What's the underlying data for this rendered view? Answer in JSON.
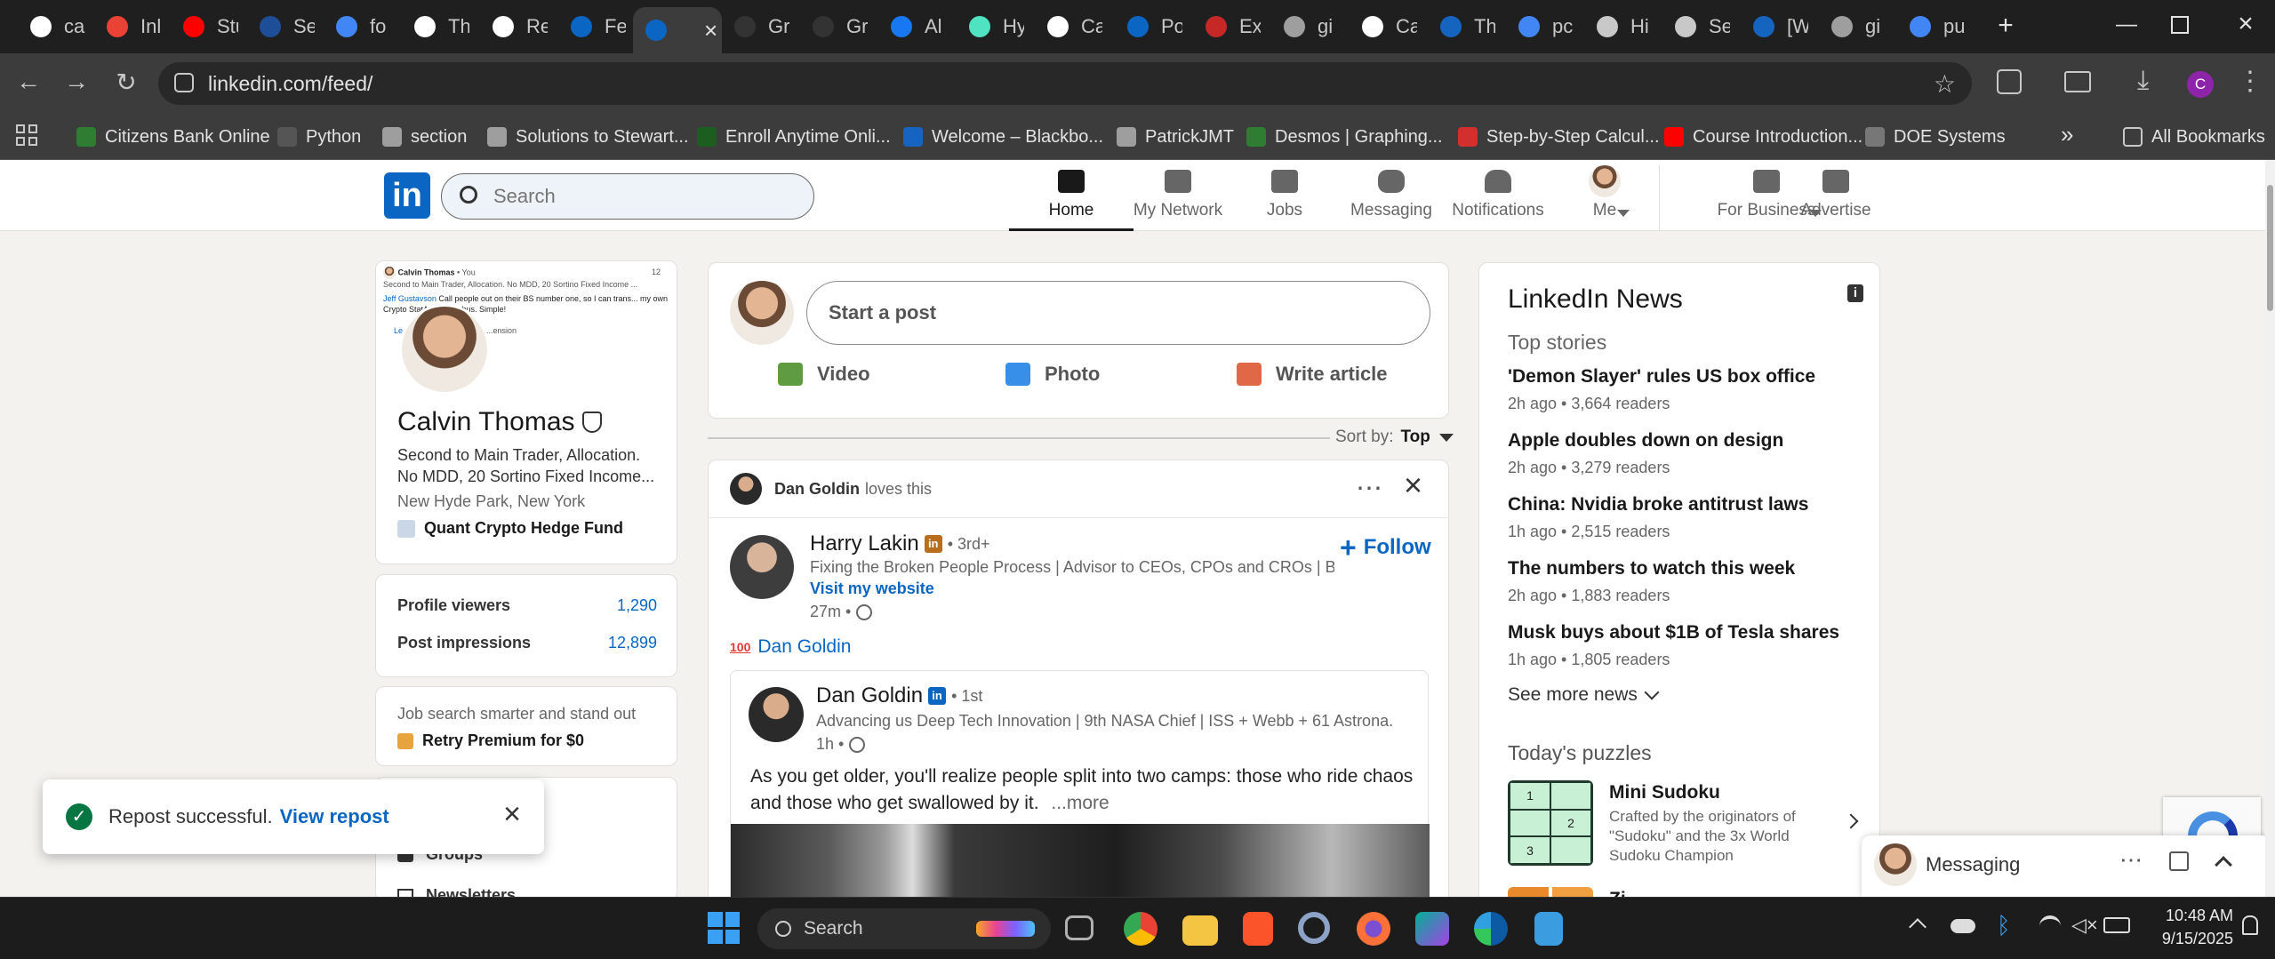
{
  "browser": {
    "tabs": [
      {
        "title": "ca",
        "icon": "github-icon",
        "color": "#ffffff"
      },
      {
        "title": "Inl",
        "icon": "gmail-icon",
        "color": "#ea4335"
      },
      {
        "title": "Stu",
        "icon": "youtube-icon",
        "color": "#ff0000"
      },
      {
        "title": "Se",
        "icon": "ssn-icon",
        "color": "#1f4e99"
      },
      {
        "title": "fo",
        "icon": "google-icon",
        "color": "#4285f4"
      },
      {
        "title": "Th",
        "icon": "r-icon",
        "color": "#ffffff"
      },
      {
        "title": "Re",
        "icon": "r-icon",
        "color": "#ffffff"
      },
      {
        "title": "Fe",
        "icon": "linkedin-icon",
        "color": "#0a66c2"
      },
      {
        "title": "",
        "icon": "linkedin-icon",
        "color": "#0a66c2",
        "active": true
      },
      {
        "title": "Gr",
        "icon": "grok-icon",
        "color": "#333333"
      },
      {
        "title": "Gr",
        "icon": "grok-icon",
        "color": "#333333"
      },
      {
        "title": "Al",
        "icon": "meta-icon",
        "color": "#1877f2"
      },
      {
        "title": "Hy",
        "icon": "hyper-icon",
        "color": "#50e3c2"
      },
      {
        "title": "Ca",
        "icon": "x-icon",
        "color": "#ffffff"
      },
      {
        "title": "Po",
        "icon": "linkedin-icon",
        "color": "#0a66c2"
      },
      {
        "title": "Ex",
        "icon": "excel-icon",
        "color": "#c62828"
      },
      {
        "title": "gi",
        "icon": "globe-icon",
        "color": "#9e9e9e"
      },
      {
        "title": "Ca",
        "icon": "x-icon",
        "color": "#ffffff"
      },
      {
        "title": "Th",
        "icon": "thumb-icon",
        "color": "#1565c0"
      },
      {
        "title": "pc",
        "icon": "google-icon",
        "color": "#4285f4"
      },
      {
        "title": "Hi",
        "icon": "history-icon",
        "color": "#c8c8c8"
      },
      {
        "title": "Se",
        "icon": "settings-icon",
        "color": "#c8c8c8"
      },
      {
        "title": "[W",
        "icon": "plugin-icon",
        "color": "#1565c0"
      },
      {
        "title": "gi",
        "icon": "globe-icon",
        "color": "#9e9e9e"
      },
      {
        "title": "pu",
        "icon": "google-icon",
        "color": "#4285f4"
      }
    ],
    "url": "linkedin.com/feed/",
    "profile_initial": "C",
    "bookmarks": [
      {
        "label": "Citizens Bank Online",
        "color": "#2e7d32"
      },
      {
        "label": "Python",
        "color": "#555555"
      },
      {
        "label": "section",
        "color": "#9e9e9e"
      },
      {
        "label": "Solutions to Stewart...",
        "color": "#9e9e9e"
      },
      {
        "label": "Enroll Anytime Onli...",
        "color": "#1b5e20"
      },
      {
        "label": "Welcome – Blackbo...",
        "color": "#1565c0"
      },
      {
        "label": "PatrickJMT",
        "color": "#9e9e9e"
      },
      {
        "label": "Desmos | Graphing...",
        "color": "#2e7d32"
      },
      {
        "label": "Step-by-Step Calcul...",
        "color": "#d32f2f"
      },
      {
        "label": "Course Introduction...",
        "color": "#ff0000"
      },
      {
        "label": "DOE Systems",
        "color": "#777777"
      }
    ],
    "all_bookmarks": "All Bookmarks",
    "more_bookmarks": "»"
  },
  "linkedin": {
    "logo": "in",
    "search_placeholder": "Search",
    "nav": [
      {
        "label": "Home",
        "icon": "home-icon",
        "active": true
      },
      {
        "label": "My Network",
        "icon": "network-icon"
      },
      {
        "label": "Jobs",
        "icon": "jobs-icon"
      },
      {
        "label": "Messaging",
        "icon": "messaging-icon"
      },
      {
        "label": "Notifications",
        "icon": "bell-icon"
      },
      {
        "label": "Me",
        "icon": "avatar"
      },
      {
        "label": "For Business",
        "icon": "grid-icon"
      },
      {
        "label": "Advertise",
        "icon": "advertise-icon"
      }
    ],
    "profile": {
      "banner_name": "Calvin Thomas",
      "banner_time": "• You",
      "banner_sub": "Second to Main Trader, Allocation. No MDD, 20 Sortino Fixed Income ...",
      "banner_mention": "Jeff Gustavson",
      "banner_text": "Call people out on their BS number one, so I can trans... my own Crypto StatArb Quant bus. Simple!",
      "banner_sidetext": "Le...",
      "banner_sidetext2": "...ension",
      "banner_count": "12",
      "name": "Calvin Thomas",
      "headline": "Second to Main Trader, Allocation. No MDD, 20 Sortino Fixed Income...",
      "location": "New Hyde Park, New York",
      "company": "Quant Crypto Hedge Fund",
      "stats": [
        {
          "label": "Profile viewers",
          "value": "1,290"
        },
        {
          "label": "Post impressions",
          "value": "12,899"
        }
      ],
      "premium_text": "Job search smarter and stand out",
      "premium_cta": "Retry Premium for $0",
      "extra_items": [
        "Groups",
        "Newsletters"
      ]
    },
    "share": {
      "placeholder": "Start a post",
      "actions": [
        {
          "label": "Video",
          "icon": "video-icon",
          "color": "#378fe9"
        },
        {
          "label": "Photo",
          "icon": "photo-icon",
          "color": "#378fe9"
        },
        {
          "label": "Write article",
          "icon": "article-icon",
          "color": "#e06847"
        }
      ]
    },
    "sort": {
      "label": "Sort by:",
      "value": "Top"
    },
    "post": {
      "context_name": "Dan Goldin",
      "context_action": "loves this",
      "author": "Harry Lakin",
      "author_degree": "• 3rd+",
      "author_headline": "Fixing the Broken People Process | Advisor to CEOs, CPOs and CROs | B...",
      "author_link": "Visit my website",
      "time": "27m •",
      "follow": "Follow",
      "reaction_name": "Dan Goldin",
      "reaction_badge": "100",
      "inner": {
        "author": "Dan Goldin",
        "degree": "• 1st",
        "headline": "Advancing us Deep Tech Innovation | 9th NASA Chief | ISS + Webb + 61 Astrona...",
        "time": "1h •",
        "text": "As you get older, you'll realize people split into two camps: those who ride chaos and those who get swallowed by it.",
        "more": "...more"
      }
    },
    "news": {
      "title": "LinkedIn News",
      "subtitle": "Top stories",
      "items": [
        {
          "headline": "'Demon Slayer' rules US box office",
          "meta": "2h ago • 3,664 readers"
        },
        {
          "headline": "Apple doubles down on design",
          "meta": "2h ago • 3,279 readers"
        },
        {
          "headline": "China: Nvidia broke antitrust laws",
          "meta": "1h ago • 2,515 readers"
        },
        {
          "headline": "The numbers to watch this week",
          "meta": "2h ago • 1,883 readers"
        },
        {
          "headline": "Musk buys about $1B of Tesla shares",
          "meta": "1h ago • 1,805 readers"
        }
      ],
      "see_more": "See more news",
      "info": "i"
    },
    "puzzles": {
      "title": "Today's puzzles",
      "name": "Mini Sudoku",
      "desc": "Crafted by the originators of \"Sudoku\" and the 3x World Sudoku Champion",
      "cells": [
        "1",
        "",
        "",
        "2",
        "3",
        ""
      ],
      "next_title": "Zi..."
    },
    "toast": {
      "text": "Repost successful.",
      "link": "View repost"
    },
    "messaging": {
      "label": "Messaging"
    }
  },
  "taskbar": {
    "search": "Search",
    "time": "10:48 AM",
    "date": "9/15/2025"
  }
}
